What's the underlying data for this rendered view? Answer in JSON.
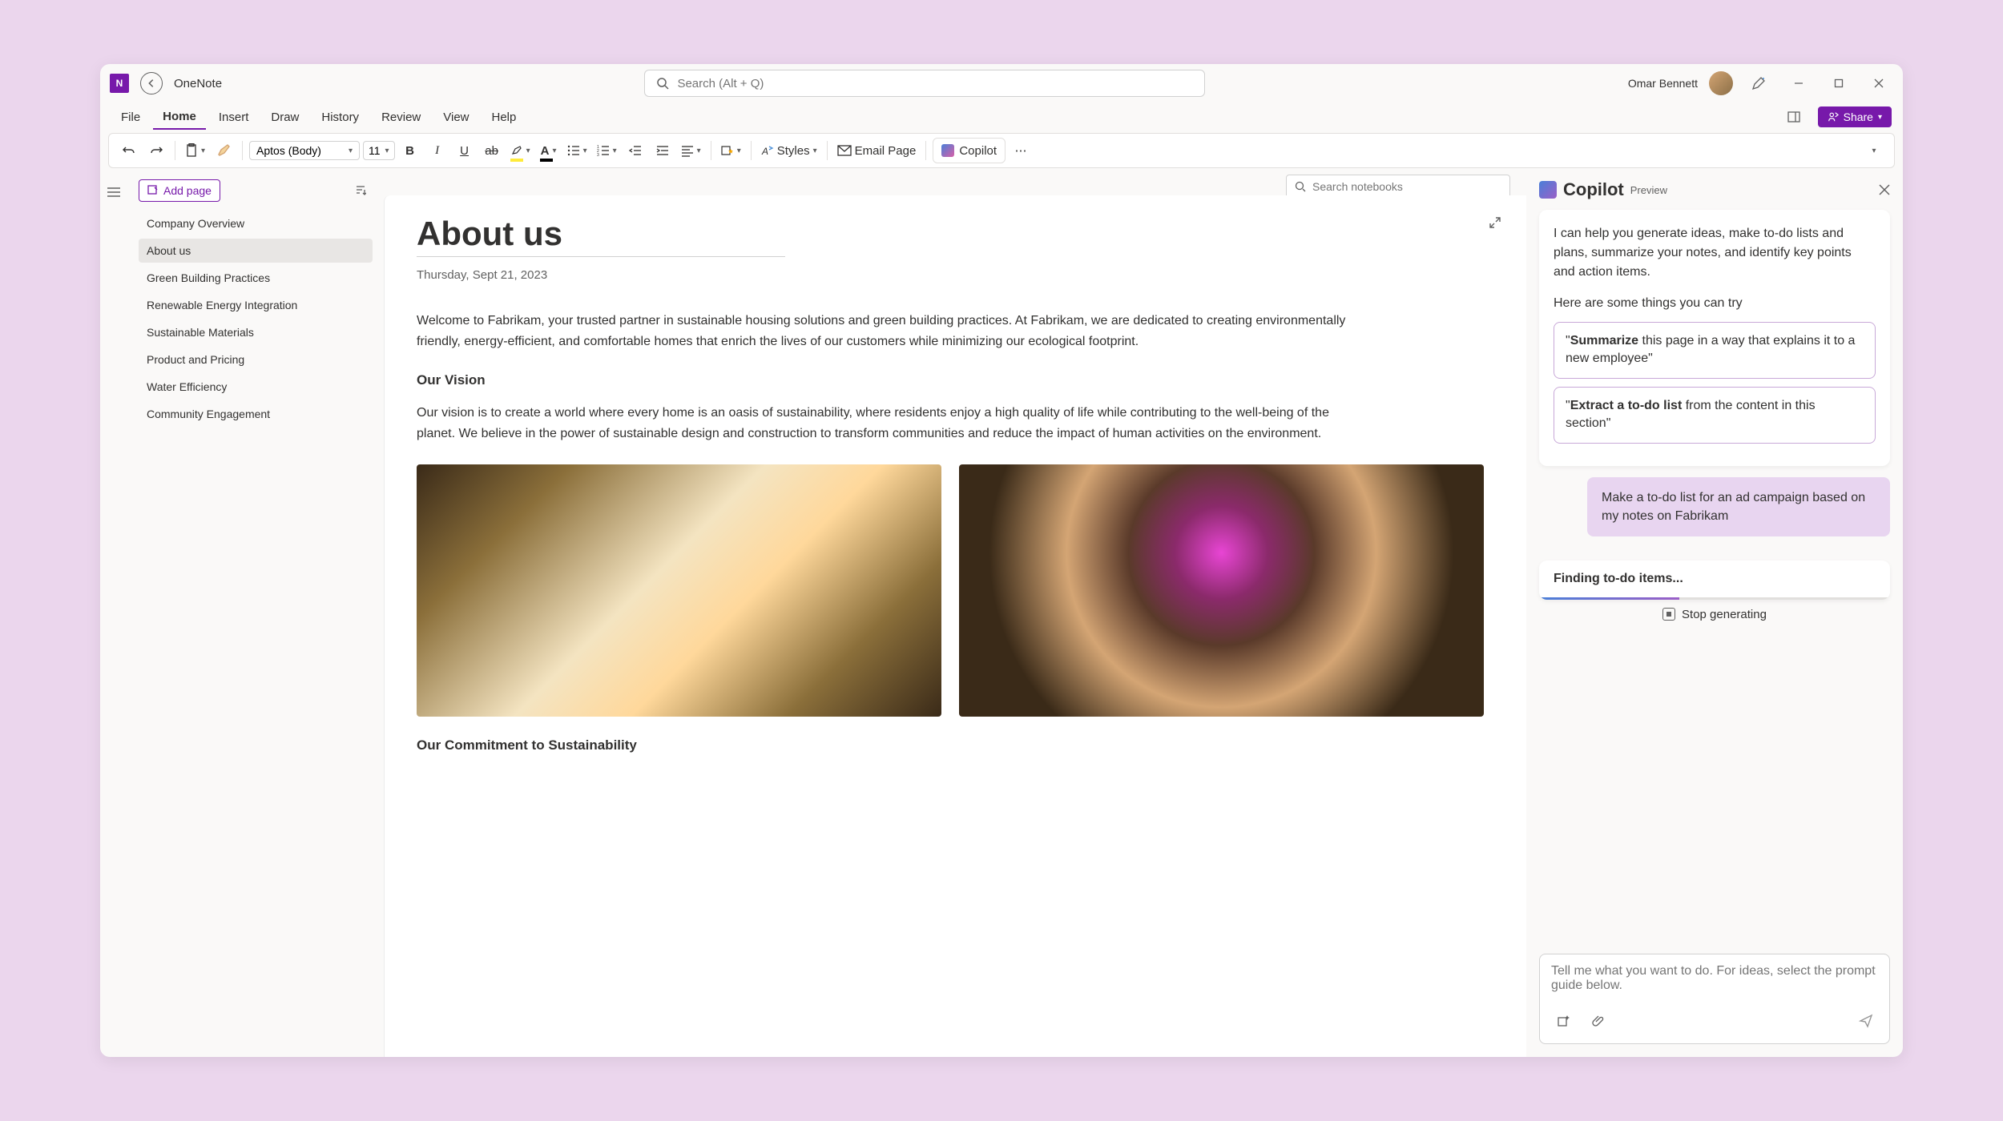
{
  "app": {
    "name": "OneNote"
  },
  "search": {
    "placeholder": "Search (Alt + Q)"
  },
  "user": {
    "name": "Omar Bennett"
  },
  "tabs": [
    "File",
    "Home",
    "Insert",
    "Draw",
    "History",
    "Review",
    "View",
    "Help"
  ],
  "activeTab": "Home",
  "share": {
    "label": "Share"
  },
  "toolbar": {
    "font": "Aptos (Body)",
    "size": "11",
    "styles": "Styles",
    "email": "Email Page",
    "copilot": "Copilot"
  },
  "notebookSearch": {
    "placeholder": "Search notebooks"
  },
  "pagePanel": {
    "addPage": "Add page",
    "items": [
      "Company Overview",
      "About us",
      "Green Building Practices",
      "Renewable Energy Integration",
      "Sustainable Materials",
      "Product and Pricing",
      "Water Efficiency",
      "Community Engagement"
    ],
    "activeIndex": 1
  },
  "page": {
    "title": "About us",
    "date": "Thursday, Sept 21, 2023",
    "intro": "Welcome to Fabrikam, your trusted partner in sustainable housing solutions and green building practices. At Fabrikam, we are dedicated to creating environmentally friendly, energy-efficient, and comfortable homes that enrich the lives of our customers while minimizing our ecological footprint.",
    "visionHeading": "Our Vision",
    "visionBody": "Our vision is to create a world where every home is an oasis of sustainability, where residents enjoy a high quality of life while contributing to the well-being of the planet. We believe in the power of sustainable design and construction to transform communities and reduce the impact of human activities on the environment.",
    "commitHeading": "Our Commitment to Sustainability"
  },
  "copilot": {
    "title": "Copilot",
    "preview": "Preview",
    "intro": "I can help you generate ideas, make to-do lists and plans, summarize your notes, and identify key points and action items.",
    "tryHeading": "Here are some things you can try",
    "sugg1_bold": "Summarize",
    "sugg1_rest": " this page in a way that explains it to a new employee\"",
    "sugg2_bold": "Extract a to-do list",
    "sugg2_rest": " from the content in this section\"",
    "userMsg": "Make a to-do list for an ad campaign based on my notes on Fabrikam",
    "status": "Finding to-do items...",
    "stop": "Stop generating",
    "inputPlaceholder": "Tell me what you want to do. For ideas, select the prompt guide below."
  }
}
